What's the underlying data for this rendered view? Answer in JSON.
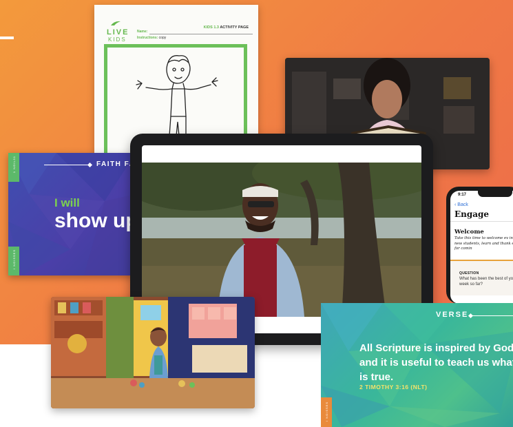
{
  "activity_page": {
    "logo_live": "LIVE",
    "logo_kids": "KIDS",
    "name_label": "Name:",
    "instructions_label": "Instructions:",
    "instructions_value": "copy",
    "header_code": "KIDS 1.3",
    "header_title": "ACTIVITY PAGE"
  },
  "faith_card": {
    "title": "FAITH FA",
    "line1": "I will",
    "line2": "show up",
    "tab_top": "1 NOIL31",
    "tab_bottom": "I NOISSES"
  },
  "phone": {
    "time": "9:17",
    "back_label": "Back",
    "title": "Engage",
    "section_title": "Welcome",
    "body_text": "Take this time to welcome ev introduce new students, learn and thank everyone for comin",
    "question_label": "QUESTION",
    "question_text": "What has been the best of your week so far?"
  },
  "verse_card": {
    "title": "VERSE",
    "text": "All Scripture is inspired by God and it is useful to teach us what is true.",
    "reference": "2 TIMOTHY 3:16 (NLT)",
    "tab": "I NOISSES"
  },
  "colors": {
    "background_orange": "#f07a45",
    "accent_green": "#6cc05a",
    "faith_blue": "#4b3fa8",
    "verse_teal": "#3ab79a",
    "verse_reference": "#f6e36a"
  }
}
